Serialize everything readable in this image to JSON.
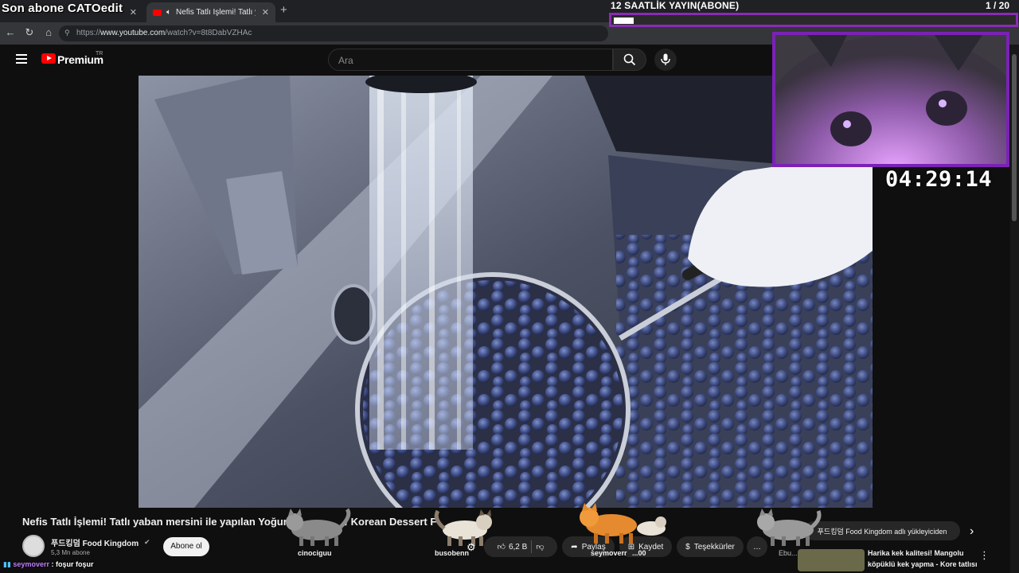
{
  "browser": {
    "tabs": [
      {
        "label": "Son abone CATOedit"
      },
      {
        "label": "Nefis Tatlı İşlemi! Tatlı yaban m"
      }
    ],
    "url_prefix": "https://",
    "url_host": "www.youtube.com",
    "url_path": "/watch?v=8t8DabVZHAc"
  },
  "youtube": {
    "brand": "Premium",
    "country": "TR",
    "search_placeholder": "Ara",
    "video_title": "Nefis Tatlı İşlemi! Tatlı yaban mersini ile yapılan Yoğurt K",
    "video_title_tail": "/ Korean Dessert F",
    "channel_name": "푸드킹덤 Food Kingdom",
    "subscribers": "5,3 Mn abone",
    "subscribe_label": "Abone ol",
    "like_count": "6,2 B",
    "share_label": "Paylaş",
    "save_label": "Kaydet",
    "thanks_label": "Teşekkürler",
    "more_label": "…",
    "chip_uploader": "푸드킹덤 Food Kingdom adlı yükleyiciden",
    "next_chevron": "›",
    "recommendation_title_1": "Harika kek kalitesi! Mangolu",
    "recommendation_title_2": "köpüklü kek yapma - Kore tatlısı",
    "recommendation_channel": "Ebu..."
  },
  "stream_overlay": {
    "goal_label": "12 SAATLİK YAYIN(ABONE)",
    "goal_count": "1  / 20",
    "goal_progress": 0.05,
    "timer": "04:29:14",
    "cat_names": [
      "cinociguu",
      "busobenn",
      "seymoverr",
      "...00"
    ],
    "chat_user": "seymoverr",
    "chat_message": ": foşur foşur"
  },
  "colors": {
    "accent_purple": "#8a2bb5",
    "yt_red": "#ff0000"
  }
}
